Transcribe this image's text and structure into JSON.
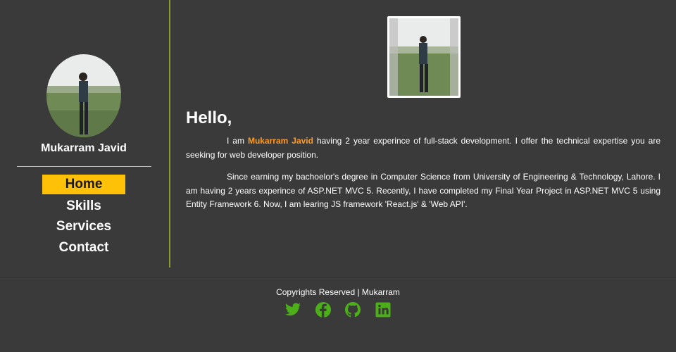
{
  "sidebar": {
    "profile_name": "Mukarram Javid",
    "nav": [
      {
        "label": "Home",
        "active": true
      },
      {
        "label": "Skills",
        "active": false
      },
      {
        "label": "Services",
        "active": false
      },
      {
        "label": "Contact",
        "active": false
      }
    ]
  },
  "main": {
    "greeting": "Hello,",
    "intro": {
      "prefix": "I am ",
      "name": "Mukarram Javid",
      "suffix": " having 2 year experince of full-stack development. I offer the technical expertise you are seeking for web developer position."
    },
    "paragraph2": "Since earning my bachoelor's degree in Computer Science from University of Engineering & Technology, Lahore. I am having 2 years experince of ASP.NET MVC 5. Recently, I have completed my Final Year Project in ASP.NET MVC 5 using Entity Framework 6. Now, I am learing JS framework 'React.js' & 'Web API'."
  },
  "footer": {
    "copyright": "Copyrights Reserved | Mukarram",
    "socials": [
      "twitter-icon",
      "facebook-icon",
      "github-icon",
      "linkedin-icon"
    ]
  },
  "colors": {
    "background": "#3a3a3a",
    "accent": "#ffc107",
    "highlight": "#ff9a1f",
    "social": "#4caf1a",
    "divider": "#8a9a2a"
  }
}
